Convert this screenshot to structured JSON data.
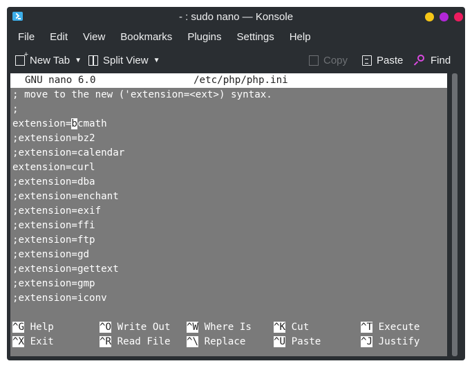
{
  "window": {
    "title": "- : sudo nano — Konsole"
  },
  "menubar": {
    "items": [
      "File",
      "Edit",
      "View",
      "Bookmarks",
      "Plugins",
      "Settings",
      "Help"
    ]
  },
  "toolbar": {
    "new_tab": "New Tab",
    "split_view": "Split View",
    "copy": "Copy",
    "paste": "Paste",
    "find": "Find"
  },
  "nano": {
    "version": "GNU nano 6.0",
    "filename": "/etc/php/php.ini",
    "lines": [
      "; move to the new ('extension=<ext>) syntax.",
      ";",
      "extension=bcmath",
      ";extension=bz2",
      ";extension=calendar",
      "extension=curl",
      ";extension=dba",
      ";extension=enchant",
      ";extension=exif",
      ";extension=ffi",
      ";extension=ftp",
      ";extension=gd",
      ";extension=gettext",
      ";extension=gmp",
      ";extension=iconv"
    ],
    "cursor_line": {
      "before": "extension=",
      "char": "b",
      "after": "cmath"
    },
    "shortcuts_row1": [
      {
        "key": "^G",
        "label": "Help"
      },
      {
        "key": "^O",
        "label": "Write Out"
      },
      {
        "key": "^W",
        "label": "Where Is"
      },
      {
        "key": "^K",
        "label": "Cut"
      },
      {
        "key": "^T",
        "label": "Execute"
      }
    ],
    "shortcuts_row2": [
      {
        "key": "^X",
        "label": "Exit"
      },
      {
        "key": "^R",
        "label": "Read File"
      },
      {
        "key": "^\\",
        "label": "Replace"
      },
      {
        "key": "^U",
        "label": "Paste"
      },
      {
        "key": "^J",
        "label": "Justify"
      }
    ]
  }
}
